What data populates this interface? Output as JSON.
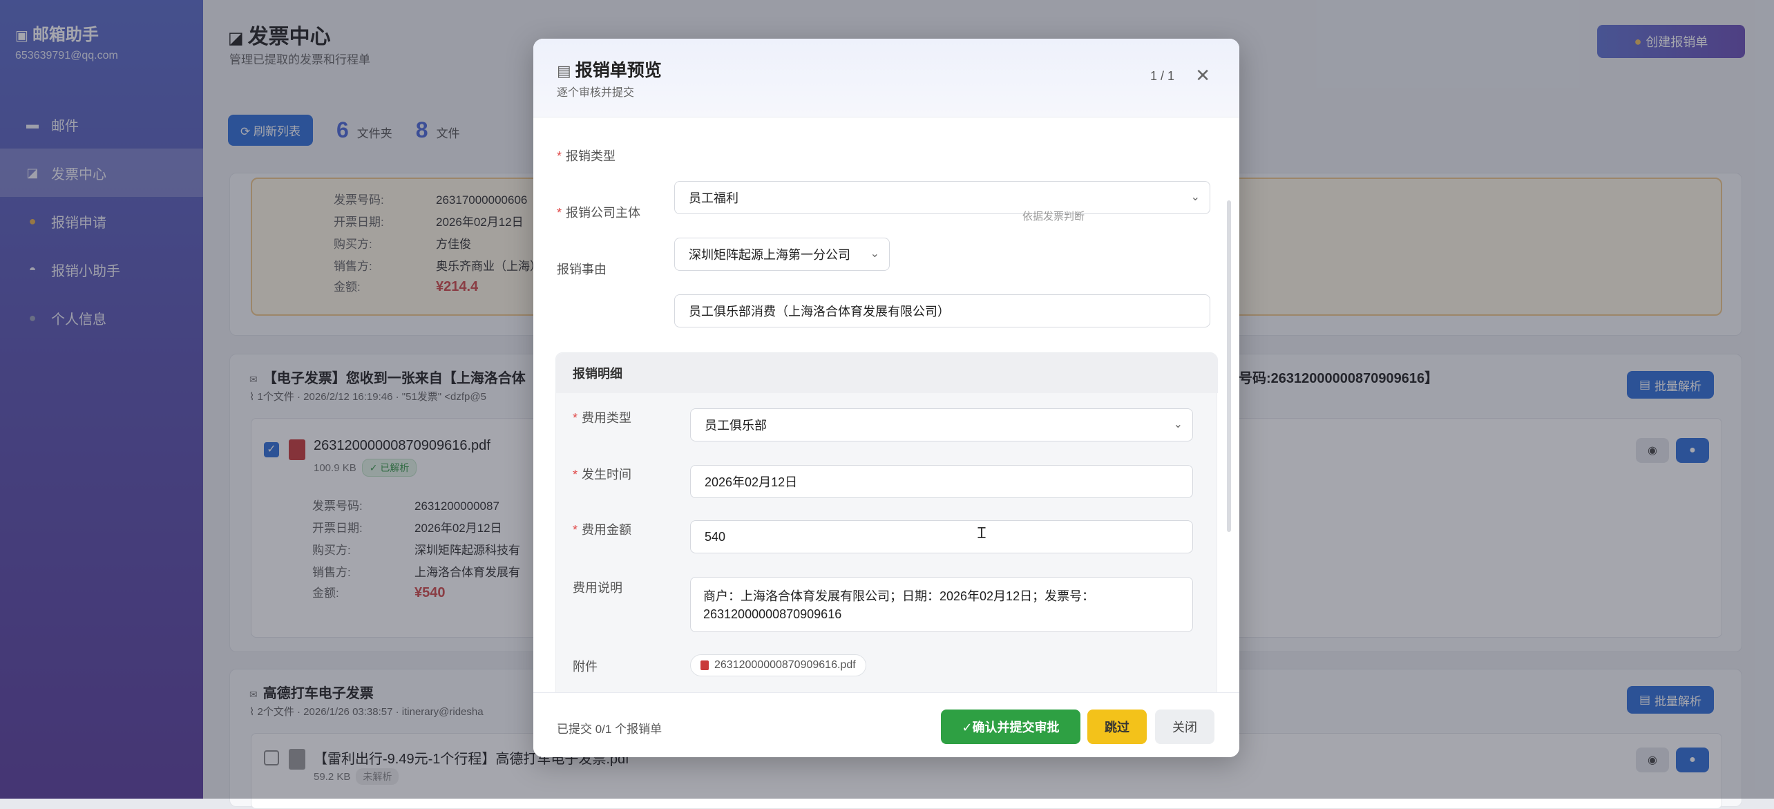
{
  "app": {
    "name": "邮箱助手",
    "account": "653639791@qq.com"
  },
  "nav": [
    {
      "icon": "mail-icon",
      "glyph": "▬",
      "label": "邮件"
    },
    {
      "icon": "folder-icon",
      "glyph": "◪",
      "label": "发票中心"
    },
    {
      "icon": "money-bag-icon",
      "glyph": "●",
      "label": "报销申请"
    },
    {
      "icon": "robot-icon",
      "glyph": "◓",
      "label": "报销小助手"
    },
    {
      "icon": "user-icon",
      "glyph": "●",
      "label": "个人信息"
    }
  ],
  "page": {
    "title": "发票中心",
    "subtitle": "管理已提取的发票和行程单",
    "create_button": "创建报销单",
    "refresh_button": "刷新列表",
    "stats": [
      {
        "num": "6",
        "label": "文件夹"
      },
      {
        "num": "8",
        "label": "文件"
      }
    ]
  },
  "top_invoice": {
    "fields": [
      {
        "k": "发票号码:",
        "v": "26317000000606"
      },
      {
        "k": "开票日期:",
        "v": "2026年02月12日"
      },
      {
        "k": "购买方:",
        "v": "方佳俊"
      },
      {
        "k": "销售方:",
        "v": "奥乐齐商业（上海）"
      },
      {
        "k": "金额:",
        "v": "¥214.4"
      }
    ]
  },
  "email1": {
    "title": "【电子发票】您收到一张来自【上海洛合体",
    "title_tail": "号码:26312000000870909616】",
    "meta": "1个文件 · 2026/2/12 16:19:46 · \"51发票\" <dzfp@5",
    "batch_button": "批量解析",
    "file": {
      "name": "26312000000870909616.pdf",
      "size": "100.9 KB",
      "status": "✓ 已解析",
      "fields": [
        {
          "k": "发票号码:",
          "v": "2631200000087"
        },
        {
          "k": "开票日期:",
          "v": "2026年02月12日"
        },
        {
          "k": "购买方:",
          "v": "深圳矩阵起源科技有"
        },
        {
          "k": "销售方:",
          "v": "上海洛合体育发展有"
        },
        {
          "k": "金额:",
          "v": "¥540"
        }
      ]
    }
  },
  "email2": {
    "title": "高德打车电子发票",
    "meta": "2个文件 · 2026/1/26 03:38:57 · itinerary@ridesha",
    "batch_button": "批量解析",
    "file": {
      "name": "【雷利出行-9.49元-1个行程】高德打车电子发票.pdf",
      "size": "59.2 KB",
      "status": "未解析"
    }
  },
  "modal": {
    "title": "报销单预览",
    "subtitle": "逐个审核并提交",
    "pager": "1 / 1",
    "close_symbol": "✕",
    "fields": {
      "type_label": "报销类型",
      "type_value": "员工福利",
      "company_label": "报销公司主体",
      "company_value": "深圳矩阵起源上海第一分公司",
      "company_hint": "依据发票判断",
      "reason_label": "报销事由",
      "reason_value": "员工俱乐部消费（上海洛合体育发展有限公司）"
    },
    "detail": {
      "header": "报销明细",
      "cost_type_label": "费用类型",
      "cost_type_value": "员工俱乐部",
      "date_label": "发生时间",
      "date_value": "2026年02月12日",
      "amount_label": "费用金额",
      "amount_value": "540",
      "desc_label": "费用说明",
      "desc_value": "商户：上海洛合体育发展有限公司；日期：2026年02月12日；发票号：26312000000870909616",
      "attach_label": "附件",
      "attach_value": "26312000000870909616.pdf"
    },
    "footer": {
      "status": "已提交 0/1 个报销单",
      "confirm": "✓确认并提交审批",
      "skip": "跳过",
      "close": "关闭"
    }
  },
  "colors": {
    "primary": "#2f6fd8",
    "success": "#2ea043",
    "warning": "#f3c21a",
    "danger": "#e04848"
  }
}
